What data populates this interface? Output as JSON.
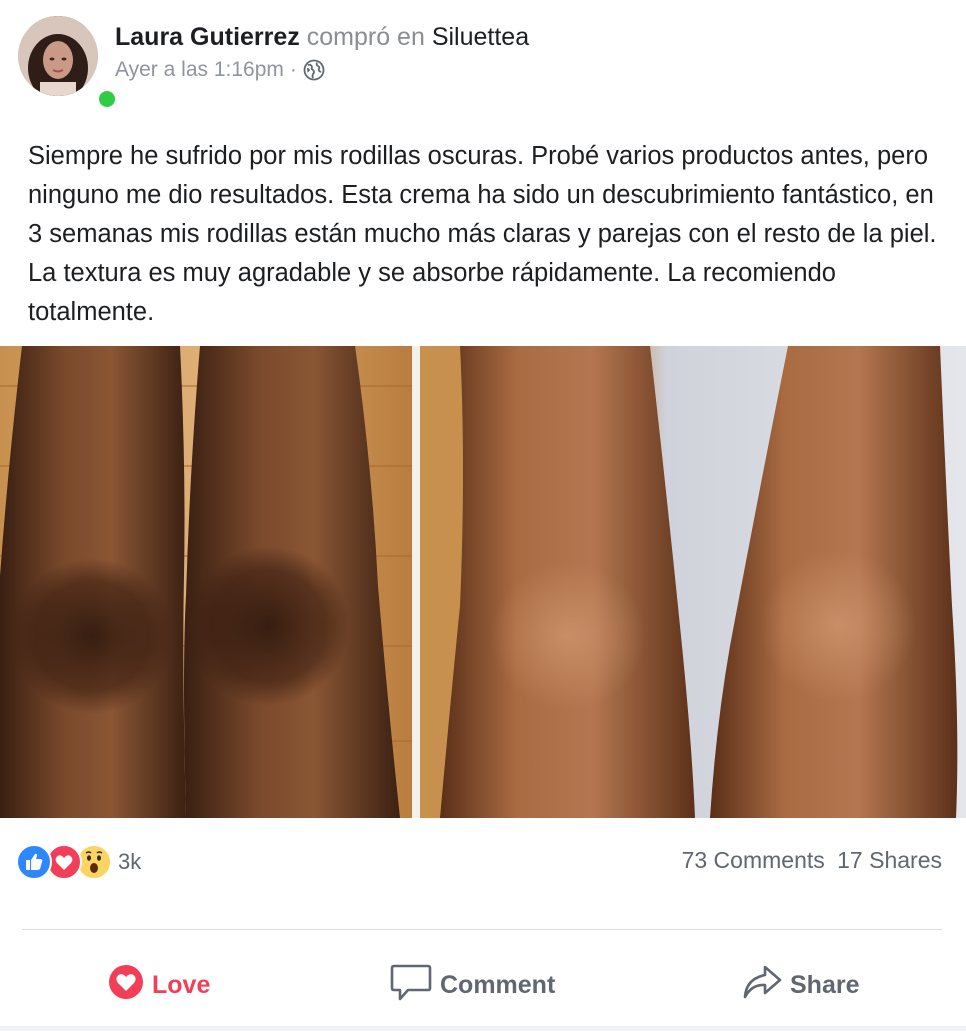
{
  "post": {
    "author": {
      "name": "Laura Gutierrez",
      "verb": "compró en",
      "place": "Siluettea",
      "online": true
    },
    "timestamp": "Ayer a las 1:16pm",
    "separator": "·",
    "privacy_icon": "globe-icon",
    "text": "Siempre he sufrido por mis rodillas oscuras. Probé varios productos antes, pero ninguno me dio resultados. Esta crema ha sido un descubrimiento fantástico, en 3 semanas mis rodillas están mucho más claras y parejas con el resto de la piel. La textura es muy agradable y se absorbe rápidamente. La recomiendo totalmente."
  },
  "reactions": {
    "icons": [
      "like-reaction-icon",
      "love-reaction-icon",
      "wow-reaction-icon"
    ],
    "count": "3k"
  },
  "stats": {
    "comments": "73 Comments",
    "shares": "17 Shares"
  },
  "actions": {
    "love": "Love",
    "comment": "Comment",
    "share": "Share"
  },
  "colors": {
    "love": "#f33e58",
    "like": "#2d88ff",
    "wow": "#fcd462",
    "online": "#31cc46",
    "muted": "#606770"
  }
}
